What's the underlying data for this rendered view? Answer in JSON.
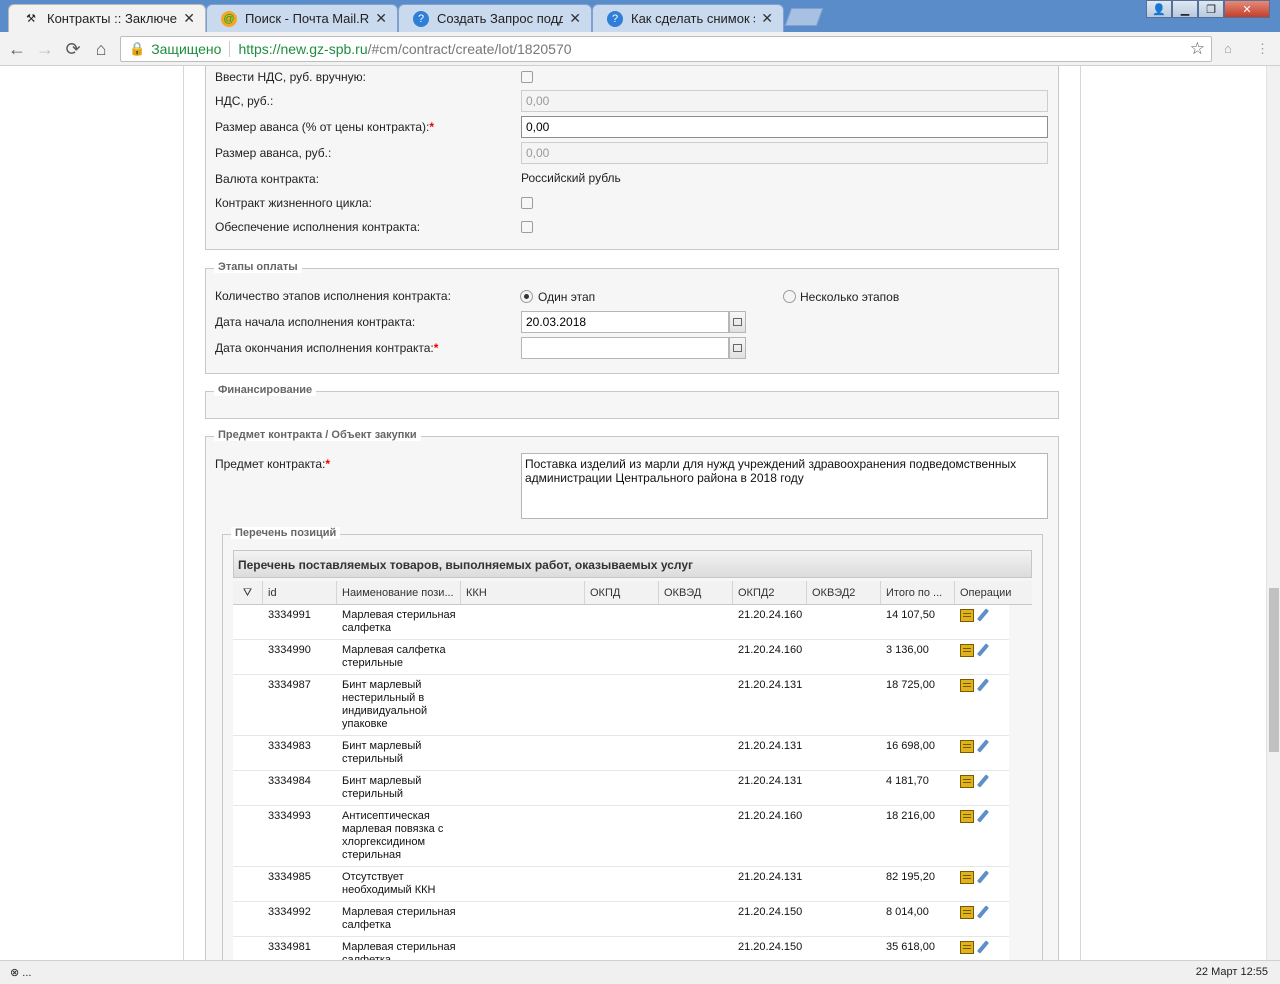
{
  "browser": {
    "tabs": [
      {
        "title": "Контракты :: Заключени",
        "favicon": "hammer-icon"
      },
      {
        "title": "Поиск - Почта Mail.Ru",
        "favicon": "mailru-icon"
      },
      {
        "title": "Создать Запрос поддер",
        "favicon": "help-icon"
      },
      {
        "title": "Как сделать снимок экр",
        "favicon": "help-icon"
      }
    ],
    "secure_label": "Защищено",
    "url_host": "https://new.gz-spb.ru",
    "url_path": "/#cm/contract/create/lot/1820570",
    "nav": {
      "back": "←",
      "forward": "→",
      "reload": "⟳",
      "home": "⌂"
    }
  },
  "form": {
    "vat_manual_label": "Ввести НДС, руб. вручную:",
    "vat_label": "НДС, руб.:",
    "vat_value": "0,00",
    "advance_percent_label": "Размер аванса (% от цены контракта):",
    "advance_percent_value": "0,00",
    "advance_rub_label": "Размер аванса, руб.:",
    "advance_rub_value": "0,00",
    "currency_label": "Валюта контракта:",
    "currency_value": "Российский рубль",
    "lifecycle_label": "Контракт жизненного цикла:",
    "security_label": "Обеспечение исполнения контракта:"
  },
  "payment_stages": {
    "legend": "Этапы оплаты",
    "count_label": "Количество этапов исполнения контракта:",
    "option_one": "Один этап",
    "option_many": "Несколько этапов",
    "start_label": "Дата начала исполнения контракта:",
    "start_value": "20.03.2018",
    "end_label": "Дата окончания исполнения контракта:",
    "end_value": ""
  },
  "financing": {
    "legend": "Финансирование"
  },
  "subject": {
    "legend": "Предмет контракта / Объект закупки",
    "label": "Предмет контракта:",
    "value": "Поставка изделий из марли для нужд учреждений здравоохранения подведомственных администрации Центрального района в 2018 году"
  },
  "positions": {
    "legend": "Перечень позиций",
    "grid_title": "Перечень поставляемых товаров, выполняемых работ, оказываемых услуг",
    "columns": [
      "id",
      "Наименование пози...",
      "ККН",
      "ОКПД",
      "ОКВЭД",
      "ОКПД2",
      "ОКВЭД2",
      "Итого по ...",
      "Операции"
    ],
    "rows": [
      {
        "id": "3334991",
        "name": "Марлевая стерильная салфетка",
        "kkn": "",
        "okpd": "",
        "okved": "",
        "okpd2": "21.20.24.160",
        "okved2": "",
        "total": "14 107,50"
      },
      {
        "id": "3334990",
        "name": "Марлевая салфетка стерильные",
        "kkn": "",
        "okpd": "",
        "okved": "",
        "okpd2": "21.20.24.160",
        "okved2": "",
        "total": "3 136,00"
      },
      {
        "id": "3334987",
        "name": "Бинт марлевый нестерильный в индивидуальной упаковке",
        "kkn": "",
        "okpd": "",
        "okved": "",
        "okpd2": "21.20.24.131",
        "okved2": "",
        "total": "18 725,00"
      },
      {
        "id": "3334983",
        "name": "Бинт марлевый стерильный",
        "kkn": "",
        "okpd": "",
        "okved": "",
        "okpd2": "21.20.24.131",
        "okved2": "",
        "total": "16 698,00"
      },
      {
        "id": "3334984",
        "name": "Бинт марлевый стерильный",
        "kkn": "",
        "okpd": "",
        "okved": "",
        "okpd2": "21.20.24.131",
        "okved2": "",
        "total": "4 181,70"
      },
      {
        "id": "3334993",
        "name": "Антисептическая марлевая повязка с хлоргексидином стерильная",
        "kkn": "",
        "okpd": "",
        "okved": "",
        "okpd2": "21.20.24.160",
        "okved2": "",
        "total": "18 216,00"
      },
      {
        "id": "3334985",
        "name": "Отсутствует необходимый ККН",
        "kkn": "",
        "okpd": "",
        "okved": "",
        "okpd2": "21.20.24.131",
        "okved2": "",
        "total": "82 195,20"
      },
      {
        "id": "3334992",
        "name": "Марлевая стерильная салфетка",
        "kkn": "",
        "okpd": "",
        "okved": "",
        "okpd2": "21.20.24.150",
        "okved2": "",
        "total": "8 014,00"
      },
      {
        "id": "3334981",
        "name": "Марлевая стерильная салфетка",
        "kkn": "",
        "okpd": "",
        "okved": "",
        "okpd2": "21.20.24.150",
        "okved2": "",
        "total": "35 618,00"
      }
    ]
  },
  "statusbar": {
    "left": "⊗ ...",
    "datetime": "22 Март 12:55"
  }
}
